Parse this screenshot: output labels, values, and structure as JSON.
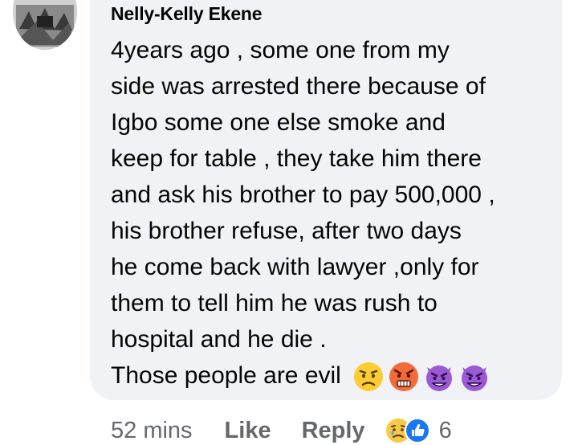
{
  "comment": {
    "author": "Nelly-Kelly Ekene",
    "lines": [
      "4years ago , some one from my",
      "side was arrested there because of",
      "Igbo some one else smoke and",
      "keep for table , they take him there",
      "and ask his brother to pay 500,000 ,",
      "his brother refuse, after two days",
      "he come back with lawyer ,only for",
      "them to tell him he was rush to",
      "hospital and he die .",
      "Those people are evil"
    ],
    "trailing_emojis": [
      "frowning-face-emoji",
      "angry-face-emoji",
      "smiling-devil-emoji",
      "smiling-devil-emoji"
    ]
  },
  "actions": {
    "time": "52 mins",
    "like_label": "Like",
    "reply_label": "Reply",
    "reactions": [
      "sad-reaction-icon",
      "like-reaction-icon"
    ],
    "reaction_count": "6"
  },
  "colors": {
    "bubble": "#f0f2f5",
    "text": "#050505",
    "meta": "#65676b",
    "like_blue": "#1877f2"
  }
}
